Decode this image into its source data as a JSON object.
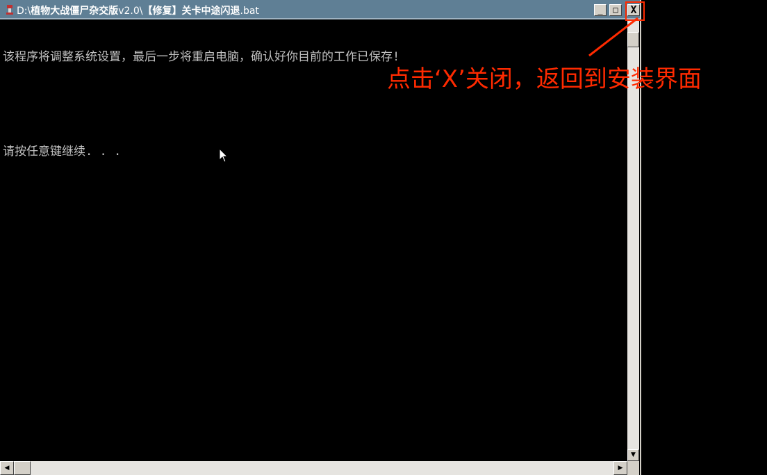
{
  "window": {
    "title_prefix": "D:\\",
    "title_bold_1": "植物大战僵尸杂交版",
    "title_version": "v2.0\\",
    "title_bold_2": "【修复】关卡中途闪退",
    "title_suffix": ".bat",
    "icon": "batch-file-icon",
    "controls": {
      "minimize": "_",
      "maximize": "□",
      "close": "X"
    }
  },
  "console": {
    "lines": [
      "该程序将调整系统设置，最后一步将重启电脑，确认好你目前的工作已保存!",
      "",
      "请按任意键继续. . ."
    ],
    "text_color": "#c0c0c0",
    "background": "#000000"
  },
  "annotation": {
    "text": "点击‘X’关闭，返回到安装界面",
    "color": "#ff2a00"
  },
  "scrollbars": {
    "up_arrow": "▲",
    "down_arrow": "▼",
    "left_arrow": "◀",
    "right_arrow": "▶"
  }
}
